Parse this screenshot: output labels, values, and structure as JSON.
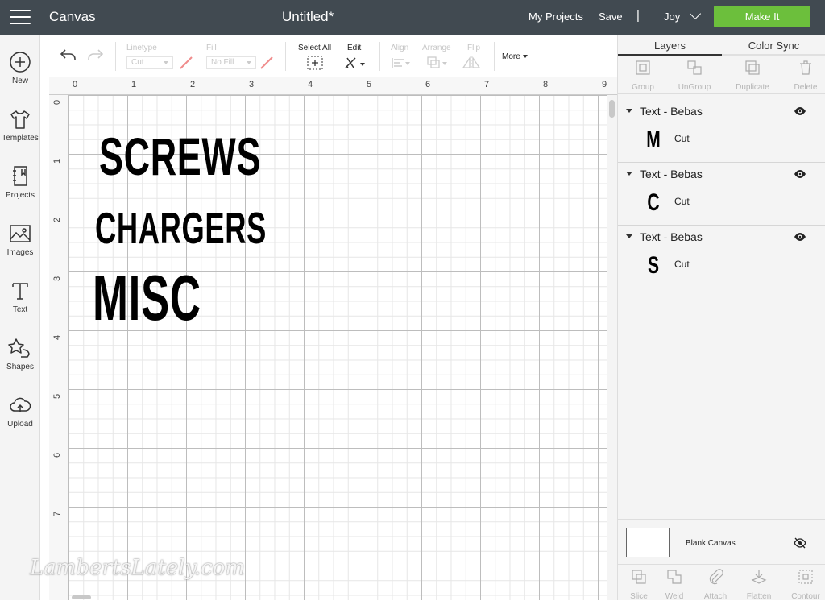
{
  "header": {
    "app_name": "Canvas",
    "document_title": "Untitled*",
    "my_projects": "My Projects",
    "save": "Save",
    "separator": "|",
    "user": "Joy",
    "make_it": "Make It"
  },
  "leftnav": {
    "items": [
      {
        "label": "New",
        "icon": "plus-circle-icon"
      },
      {
        "label": "Templates",
        "icon": "tshirt-icon"
      },
      {
        "label": "Projects",
        "icon": "notebook-icon"
      },
      {
        "label": "Images",
        "icon": "image-icon"
      },
      {
        "label": "Text",
        "icon": "text-icon"
      },
      {
        "label": "Shapes",
        "icon": "shapes-icon"
      },
      {
        "label": "Upload",
        "icon": "cloud-upload-icon"
      }
    ]
  },
  "toolbar": {
    "linetype_label": "Linetype",
    "linetype_value": "Cut",
    "fill_label": "Fill",
    "fill_value": "No Fill",
    "select_all": "Select All",
    "edit": "Edit",
    "align": "Align",
    "arrange": "Arrange",
    "flip": "Flip",
    "more": "More"
  },
  "canvas": {
    "ruler_h": [
      "0",
      "1",
      "2",
      "3",
      "4",
      "5",
      "6",
      "7",
      "8",
      "9"
    ],
    "ruler_v": [
      "0",
      "1",
      "2",
      "3",
      "4",
      "5",
      "6",
      "7"
    ],
    "texts": [
      "SCREWS",
      "CHARGERS",
      "MISC"
    ],
    "watermark": "LambertsLately.com"
  },
  "rightpanel": {
    "tabs": [
      "Layers",
      "Color Sync"
    ],
    "tools": [
      "Group",
      "UnGroup",
      "Duplicate",
      "Delete"
    ],
    "layers": [
      {
        "title": "Text - Bebas",
        "thumb": "M",
        "operation": "Cut"
      },
      {
        "title": "Text - Bebas",
        "thumb": "C",
        "operation": "Cut"
      },
      {
        "title": "Text - Bebas",
        "thumb": "S",
        "operation": "Cut"
      }
    ],
    "blank_canvas": "Blank Canvas",
    "bottom_tools": [
      "Slice",
      "Weld",
      "Attach",
      "Flatten",
      "Contour"
    ]
  },
  "colors": {
    "header_bg": "#414a51",
    "make_it_green": "#6cbf3c",
    "panel_bg": "#f4f4f4"
  }
}
